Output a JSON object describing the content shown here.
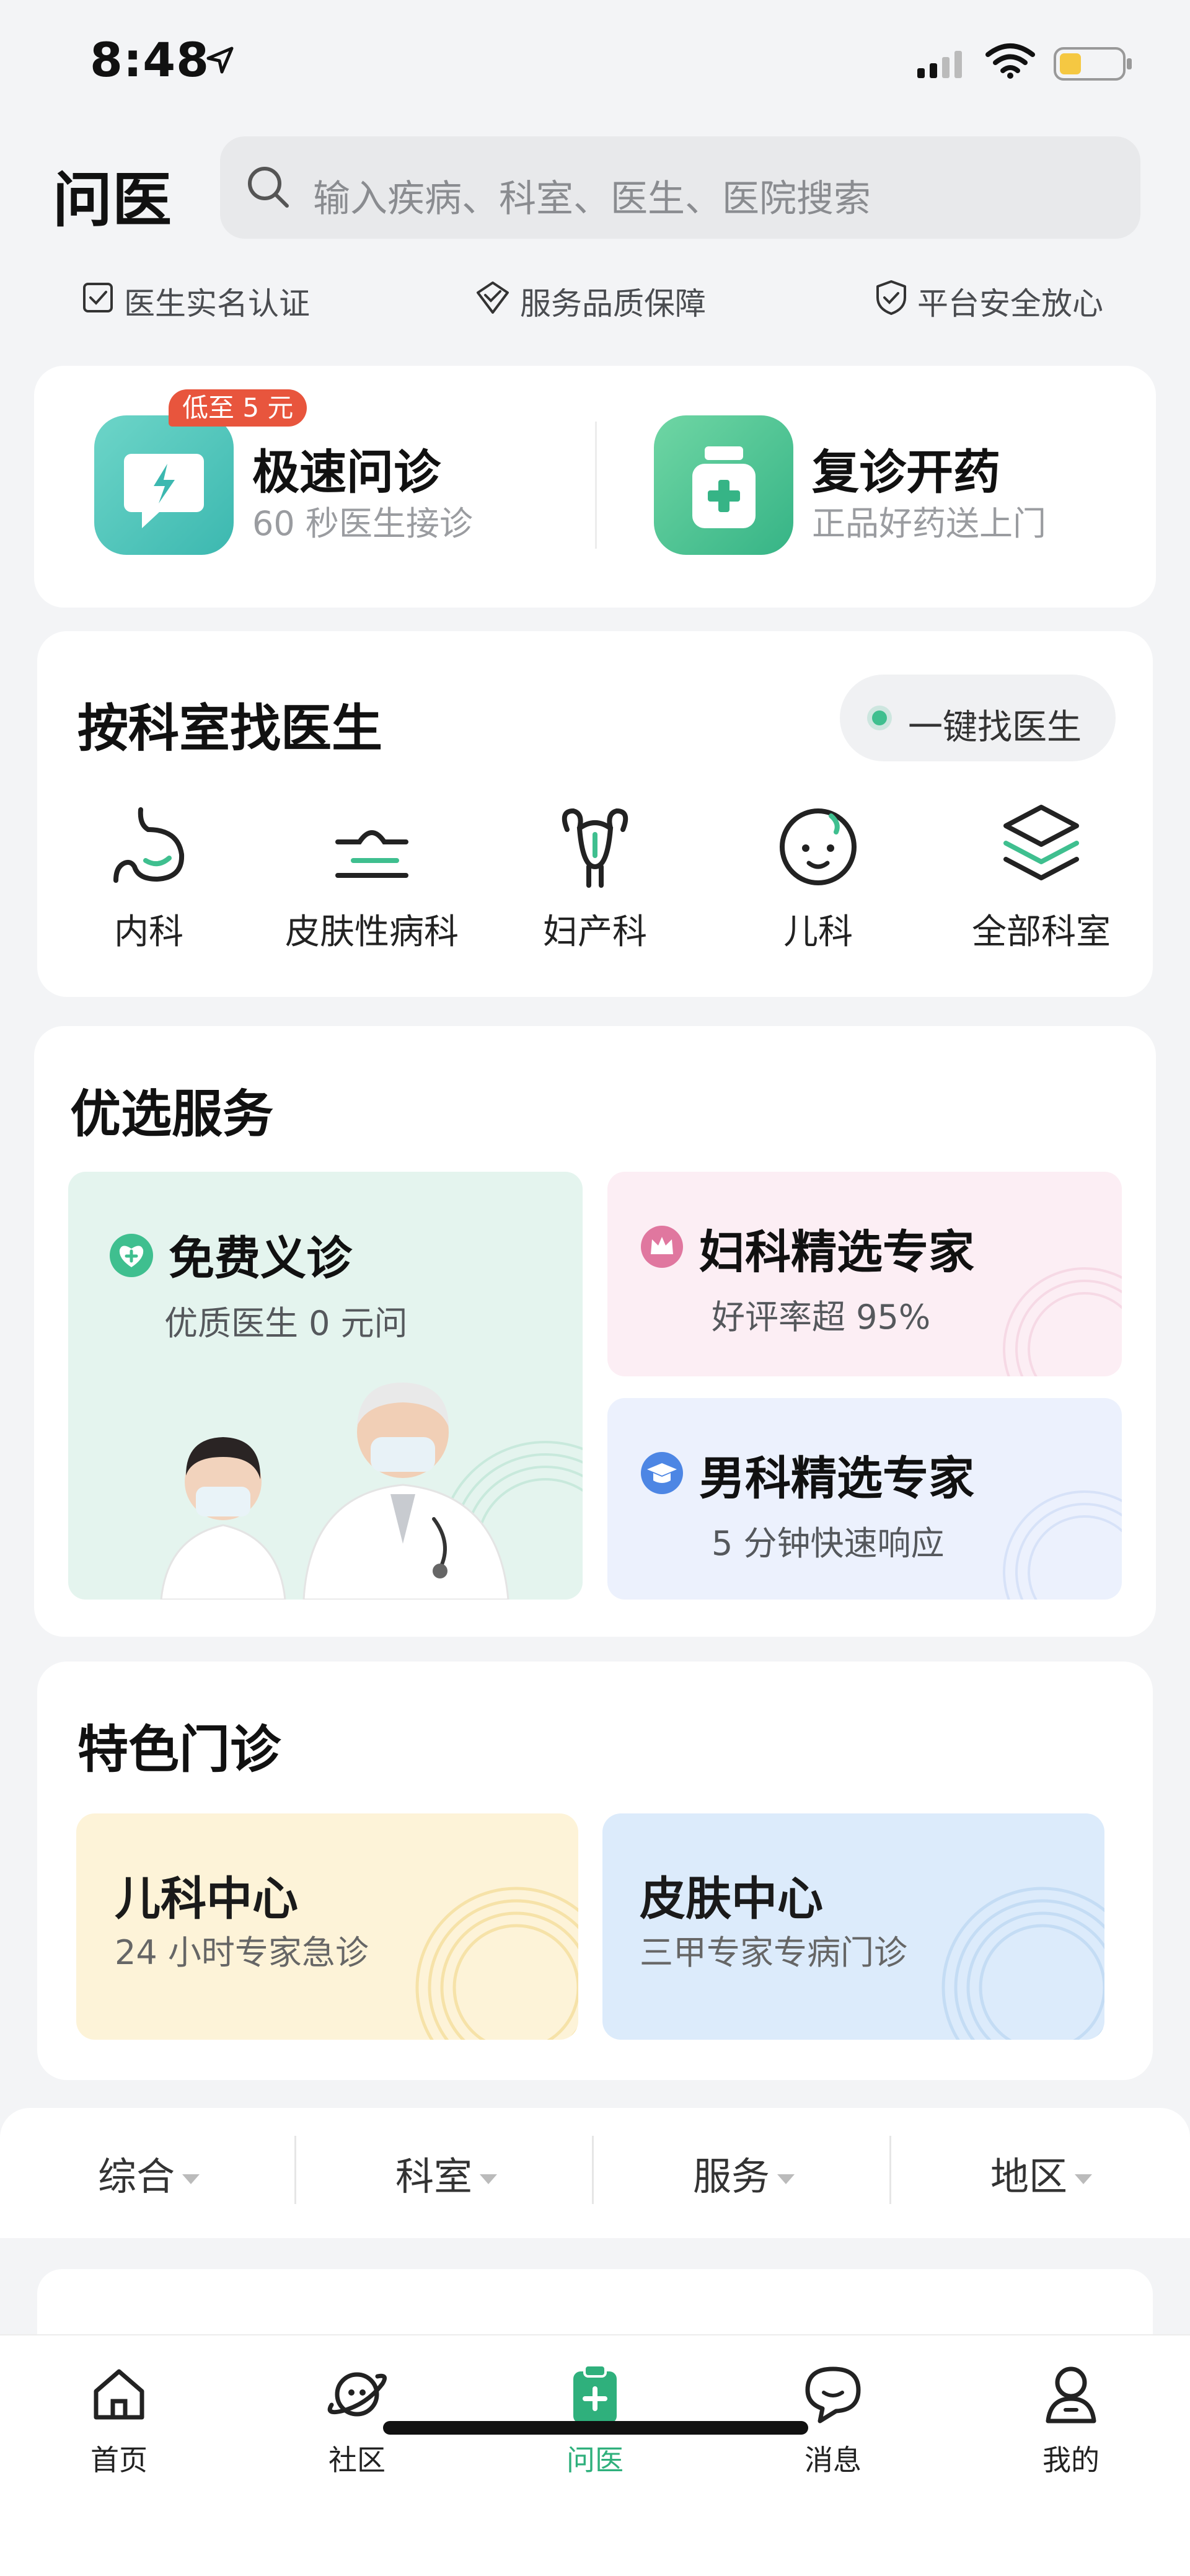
{
  "status_bar": {
    "time": "8:48"
  },
  "header": {
    "title": "问医",
    "search_placeholder": "输入疾病、科室、医生、医院搜索"
  },
  "guarantees": [
    {
      "label": "医生实名认证",
      "icon": "checkbox-icon"
    },
    {
      "label": "服务品质保障",
      "icon": "shield-heart-icon"
    },
    {
      "label": "平台安全放心",
      "icon": "shield-check-icon"
    }
  ],
  "quick": {
    "fast": {
      "badge": "低至 5 元",
      "title": "极速问诊",
      "subtitle": "60 秒医生接诊",
      "icon": "lightning-chat-icon",
      "color": "#3cc2b8"
    },
    "refill": {
      "title": "复诊开药",
      "subtitle": "正品好药送上门",
      "icon": "medicine-bottle-icon",
      "color": "#3fbf8f"
    }
  },
  "departments": {
    "title": "按科室找医生",
    "one_key": "一键找医生",
    "items": [
      {
        "label": "内科",
        "icon": "stomach-icon"
      },
      {
        "label": "皮肤性病科",
        "icon": "skin-layers-icon"
      },
      {
        "label": "妇产科",
        "icon": "uterus-icon"
      },
      {
        "label": "儿科",
        "icon": "baby-face-icon"
      },
      {
        "label": "全部科室",
        "icon": "stack-layers-icon"
      }
    ]
  },
  "services": {
    "title": "优选服务",
    "free": {
      "title": "免费义诊",
      "subtitle": "优质医生 0 元问",
      "icon": "heart-plus-icon"
    },
    "gyn": {
      "title": "妇科精选专家",
      "subtitle": "好评率超 95%",
      "icon": "crown-icon"
    },
    "male": {
      "title": "男科精选专家",
      "subtitle": "5 分钟快速响应",
      "icon": "graduation-cap-icon"
    }
  },
  "clinics": {
    "title": "特色门诊",
    "items": [
      {
        "title": "儿科中心",
        "subtitle": "24 小时专家急诊",
        "bg": "#fdf3d8"
      },
      {
        "title": "皮肤中心",
        "subtitle": "三甲专家专病门诊",
        "bg": "#dcebfb"
      }
    ]
  },
  "filters": [
    "综合",
    "科室",
    "服务",
    "地区"
  ],
  "tabs": [
    {
      "label": "首页",
      "icon": "home-icon"
    },
    {
      "label": "社区",
      "icon": "planet-icon"
    },
    {
      "label": "问医",
      "icon": "medical-clipboard-icon",
      "active": true
    },
    {
      "label": "消息",
      "icon": "chat-bubble-icon"
    },
    {
      "label": "我的",
      "icon": "person-icon"
    }
  ],
  "colors": {
    "accent": "#2fb07c",
    "badge": "#e8553d",
    "background": "#f3f4f6"
  }
}
